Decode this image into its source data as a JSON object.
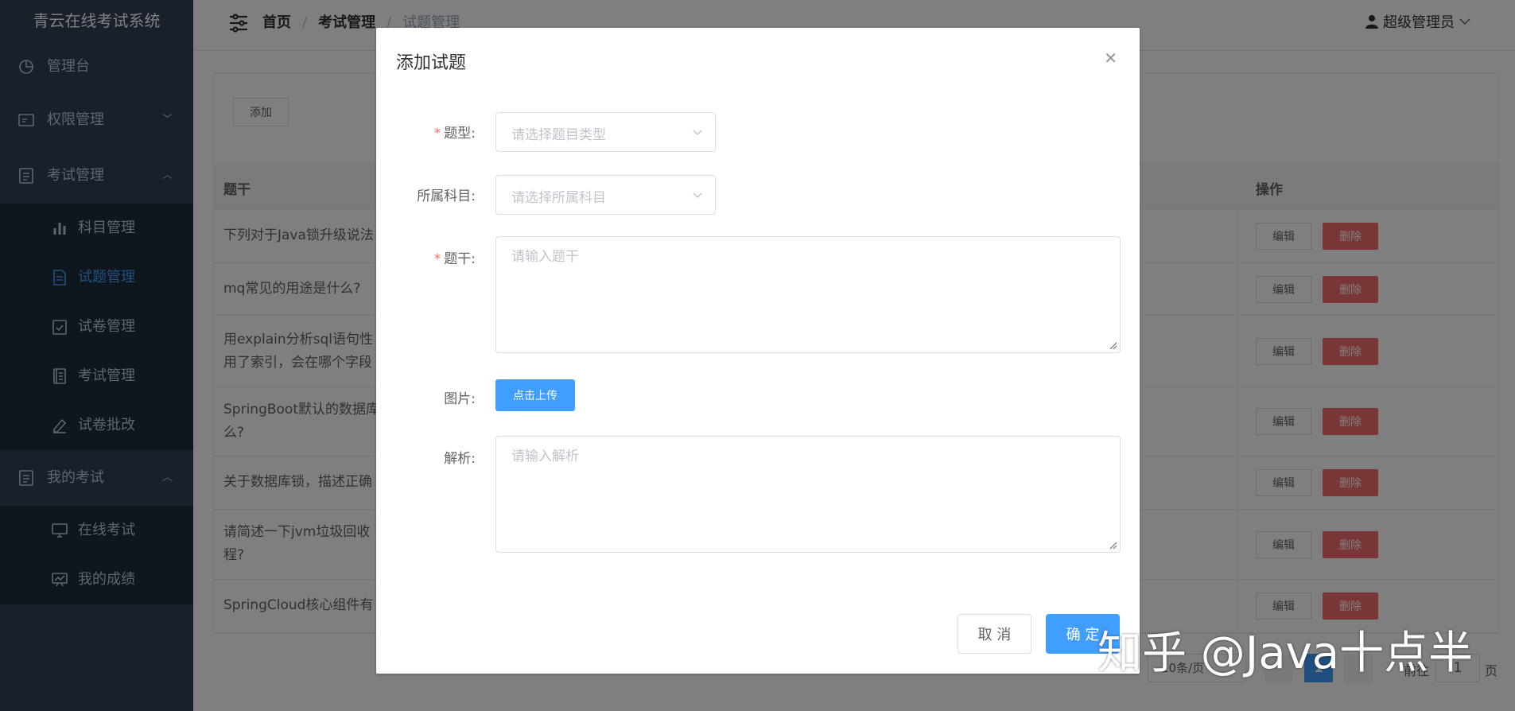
{
  "sidebar": {
    "title": "青云在线考试系统",
    "items": [
      {
        "label": "管理台",
        "icon": "dashboard-icon"
      },
      {
        "label": "权限管理",
        "icon": "permission-icon",
        "arrow": "﹀"
      },
      {
        "label": "考试管理",
        "icon": "exam-manage-icon",
        "arrow": "︿"
      }
    ],
    "exam_sub": [
      {
        "label": "科目管理",
        "icon": "bar-chart-icon"
      },
      {
        "label": "试题管理",
        "icon": "document-icon",
        "active": true
      },
      {
        "label": "试卷管理",
        "icon": "checklist-icon"
      },
      {
        "label": "考试管理",
        "icon": "notebook-icon"
      },
      {
        "label": "试卷批改",
        "icon": "pen-icon"
      }
    ],
    "my_exam": {
      "label": "我的考试",
      "icon": "my-exam-icon",
      "arrow": "︿"
    },
    "my_sub": [
      {
        "label": "在线考试",
        "icon": "monitor-icon"
      },
      {
        "label": "我的成绩",
        "icon": "chart-board-icon"
      }
    ]
  },
  "header": {
    "breadcrumb": [
      "首页",
      "考试管理",
      "试题管理"
    ],
    "user": "超级管理员"
  },
  "toolbar": {
    "add_label": "添加"
  },
  "table": {
    "headers": [
      "题干",
      "操作"
    ],
    "edit_label": "编辑",
    "delete_label": "删除",
    "rows": [
      {
        "stem": "下列对于Java锁升级说法"
      },
      {
        "stem": "mq常见的用途是什么?"
      },
      {
        "stem": "用explain分析sql语句性",
        "stem2": "用了索引，会在哪个字段"
      },
      {
        "stem": "SpringBoot默认的数据库",
        "stem2": "么?"
      },
      {
        "stem": "关于数据库锁，描述正确"
      },
      {
        "stem": "请简述一下jvm垃圾回收",
        "stem2": "程?"
      },
      {
        "stem": "SpringCloud核心组件有"
      }
    ]
  },
  "pagination": {
    "page_size": "10条/页",
    "current": "1",
    "goto": "前往",
    "goto_value": "1",
    "page_suffix": "页"
  },
  "dialog": {
    "title": "添加试题",
    "type_label": "题型:",
    "type_placeholder": "请选择题目类型",
    "subject_label": "所属科目:",
    "subject_placeholder": "请选择所属科目",
    "stem_label": "题干:",
    "stem_placeholder": "请输入题干",
    "image_label": "图片:",
    "upload_label": "点击上传",
    "analysis_label": "解析:",
    "analysis_placeholder": "请输入解析",
    "cancel_label": "取 消",
    "confirm_label": "确 定"
  },
  "watermark": "知乎 @Java十点半",
  "colors": {
    "primary": "#409eff",
    "danger": "#f56c6c",
    "sidebar_bg": "#304156",
    "submenu_bg": "#1f2d3d"
  }
}
